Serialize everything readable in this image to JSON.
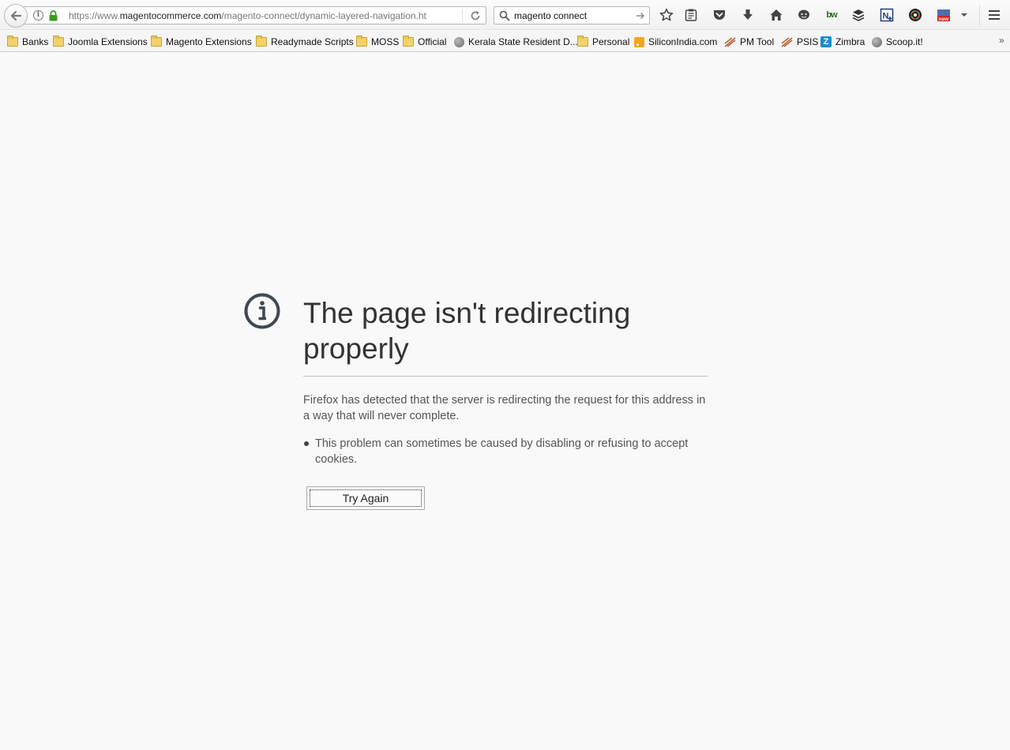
{
  "toolbar": {
    "url_prefix": "https://www.",
    "url_domain": "magentocommerce.com",
    "url_path": "/magento-connect/dynamic-layered-navigation.ht",
    "search_value": "magento connect",
    "bw_label": "bw",
    "new_badge": "new",
    "icons": [
      "back-icon",
      "info-icon",
      "lock-icon",
      "reload-icon",
      "search-icon",
      "go-arrow-icon",
      "bookmark-star-icon",
      "reading-list-icon",
      "pocket-icon",
      "download-icon",
      "home-icon",
      "chat-icon",
      "bw-icon",
      "layers-icon",
      "onenote-icon",
      "color-wheel-icon",
      "new-badge-icon",
      "dropdown-icon",
      "menu-icon"
    ]
  },
  "bookmarks": [
    {
      "label": "Banks",
      "icon": "folder-icon"
    },
    {
      "label": "Joomla Extensions",
      "icon": "folder-icon"
    },
    {
      "label": "Magento Extensions",
      "icon": "folder-icon"
    },
    {
      "label": "Readymade Scripts",
      "icon": "folder-icon"
    },
    {
      "label": "MOSS",
      "icon": "folder-icon"
    },
    {
      "label": "Official",
      "icon": "folder-icon"
    },
    {
      "label": "Kerala State Resident D...",
      "icon": "globe-icon"
    },
    {
      "label": "Personal",
      "icon": "folder-icon"
    },
    {
      "label": "SiliconIndia.com",
      "icon": "rss-icon"
    },
    {
      "label": "PM Tool",
      "icon": "pmtool-icon"
    },
    {
      "label": "PSIS",
      "icon": "pmtool-icon"
    },
    {
      "label": "Zimbra",
      "icon": "zimbra-icon"
    },
    {
      "label": "Scoop.it!",
      "icon": "globe-icon"
    }
  ],
  "bookmarks_overflow": "»",
  "error": {
    "title": "The page isn't redirecting properly",
    "description": "Firefox has detected that the server is redirecting the request for this address in a way that will never complete.",
    "bullets": [
      "This problem can sometimes be caused by disabling or refusing to accept cookies."
    ],
    "try_again_label": "Try Again",
    "icon": "info-circle-icon"
  },
  "colors": {
    "page_background": "#f9f9f9",
    "title_text": "#333333",
    "body_text": "#555555",
    "lock_green": "#3a9a22"
  }
}
